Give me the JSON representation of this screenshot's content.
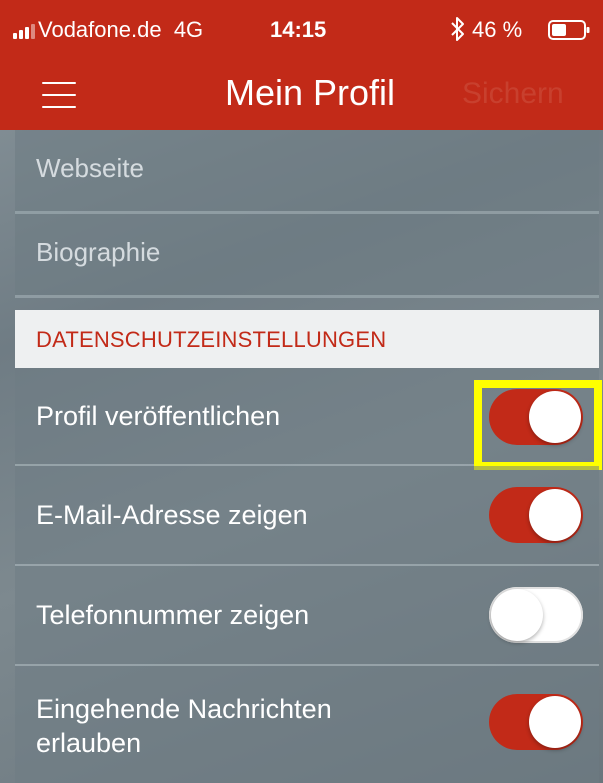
{
  "status_bar": {
    "carrier": "Vodafone.de",
    "network": "4G",
    "time": "14:15",
    "battery": "46 %",
    "bluetooth_icon": "bluetooth-icon",
    "battery_icon": "battery-icon",
    "signal_icon": "signal-icon"
  },
  "navbar": {
    "menu_icon": "hamburger-menu-icon",
    "title": "Mein Profil",
    "save_label": "Sichern"
  },
  "fields": [
    {
      "placeholder": "Webseite"
    },
    {
      "placeholder": "Biographie"
    }
  ],
  "privacy": {
    "header": "DATENSCHUTZEINSTELLUNGEN",
    "toggles": [
      {
        "label": "Profil veröffentlichen",
        "state": "on",
        "highlighted": true
      },
      {
        "label": "E-Mail-Adresse zeigen",
        "state": "on"
      },
      {
        "label": "Telefonnummer zeigen",
        "state": "off"
      },
      {
        "label": "Eingehende Nachrichten erlauben",
        "state": "on"
      }
    ]
  },
  "colors": {
    "brand_red": "#c22a18",
    "highlight_yellow": "#ffff00"
  }
}
